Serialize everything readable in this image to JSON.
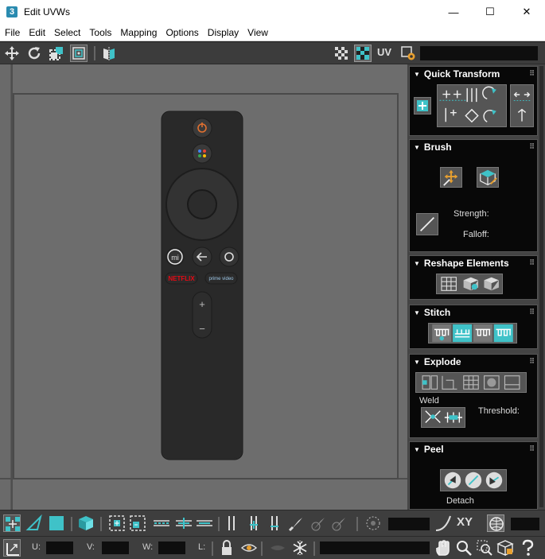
{
  "window": {
    "title": "Edit UVWs",
    "app_icon": "3",
    "minimize": "—",
    "maximize": "☐",
    "close": "✕"
  },
  "menu": [
    "File",
    "Edit",
    "Select",
    "Tools",
    "Mapping",
    "Options",
    "Display",
    "View"
  ],
  "toolbar_top": {
    "uv_label": "UV"
  },
  "remote": {
    "brand_left": "NETFLIX",
    "brand_right": "prime video",
    "mi": "mi",
    "plus": "+",
    "minus": "−"
  },
  "rollouts": {
    "quick_transform": {
      "title": "Quick Transform"
    },
    "brush": {
      "title": "Brush",
      "strength": "Strength:",
      "falloff": "Falloff:"
    },
    "reshape": {
      "title": "Reshape Elements"
    },
    "stitch": {
      "title": "Stitch"
    },
    "explode": {
      "title": "Explode",
      "weld": "Weld",
      "threshold": "Threshold:"
    },
    "peel": {
      "title": "Peel",
      "detach": "Detach"
    }
  },
  "bottom": {
    "xy": "XY",
    "u": "U:",
    "v": "V:",
    "w": "W:",
    "l": "L:"
  },
  "colors": {
    "accent": "#3fc2c8",
    "panel_bg": "#080808",
    "viewport": "#6d6d6d"
  }
}
